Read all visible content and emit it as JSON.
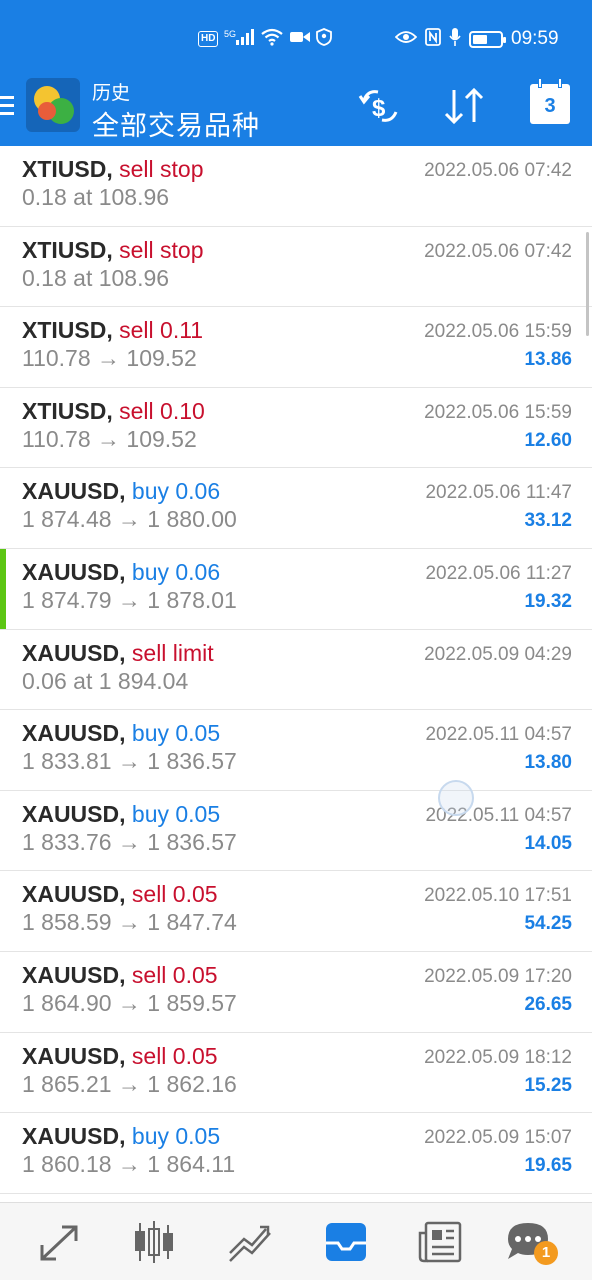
{
  "status_bar": {
    "left_icons": [
      "hd-icon",
      "5g-signal-icon",
      "wifi-icon",
      "video-camera-icon",
      "shield-icon"
    ],
    "hd_label": "HD",
    "net_label": "5G",
    "right_icons": [
      "eye-icon",
      "nfc-icon",
      "microphone-icon",
      "battery-icon"
    ],
    "time": "09:59"
  },
  "header": {
    "subtitle": "历史",
    "title": "全部交易品种",
    "calendar_day": "3",
    "actions": [
      "dollar-exchange-icon",
      "sort-icon",
      "calendar-icon"
    ]
  },
  "colors": {
    "accent": "#1a7fe4",
    "sell": "#c8102e",
    "buy": "#1a7fe4",
    "profit": "#1a7fe4",
    "selected_marker": "#5cc614"
  },
  "trades": [
    {
      "symbol": "XTIUSD,",
      "action": "sell stop",
      "side": "sell",
      "detail": "0.18 at 108.96",
      "date": "2022.05.06 07:42",
      "profit": ""
    },
    {
      "symbol": "XTIUSD,",
      "action": "sell stop",
      "side": "sell",
      "detail": "0.18 at 108.96",
      "date": "2022.05.06 07:42",
      "profit": ""
    },
    {
      "symbol": "XTIUSD,",
      "action": "sell 0.11",
      "side": "sell",
      "detail": "110.78 → 109.52",
      "date": "2022.05.06 15:59",
      "profit": "13.86"
    },
    {
      "symbol": "XTIUSD,",
      "action": "sell 0.10",
      "side": "sell",
      "detail": "110.78 → 109.52",
      "date": "2022.05.06 15:59",
      "profit": "12.60"
    },
    {
      "symbol": "XAUUSD,",
      "action": "buy 0.06",
      "side": "buy",
      "detail": "1 874.48 → 1 880.00",
      "date": "2022.05.06 11:47",
      "profit": "33.12"
    },
    {
      "symbol": "XAUUSD,",
      "action": "buy 0.06",
      "side": "buy",
      "detail": "1 874.79 → 1 878.01",
      "date": "2022.05.06 11:27",
      "profit": "19.32"
    },
    {
      "symbol": "XAUUSD,",
      "action": "sell limit",
      "side": "sell",
      "detail": "0.06 at 1 894.04",
      "date": "2022.05.09 04:29",
      "profit": ""
    },
    {
      "symbol": "XAUUSD,",
      "action": "buy 0.05",
      "side": "buy",
      "detail": "1 833.81 → 1 836.57",
      "date": "2022.05.11 04:57",
      "profit": "13.80"
    },
    {
      "symbol": "XAUUSD,",
      "action": "buy 0.05",
      "side": "buy",
      "detail": "1 833.76 → 1 836.57",
      "date": "2022.05.11 04:57",
      "profit": "14.05"
    },
    {
      "symbol": "XAUUSD,",
      "action": "sell 0.05",
      "side": "sell",
      "detail": "1 858.59 → 1 847.74",
      "date": "2022.05.10 17:51",
      "profit": "54.25"
    },
    {
      "symbol": "XAUUSD,",
      "action": "sell 0.05",
      "side": "sell",
      "detail": "1 864.90 → 1 859.57",
      "date": "2022.05.09 17:20",
      "profit": "26.65"
    },
    {
      "symbol": "XAUUSD,",
      "action": "sell 0.05",
      "side": "sell",
      "detail": "1 865.21 → 1 862.16",
      "date": "2022.05.09 18:12",
      "profit": "15.25"
    },
    {
      "symbol": "XAUUSD,",
      "action": "buy 0.05",
      "side": "buy",
      "detail": "1 860.18 → 1 864.11",
      "date": "2022.05.09 15:07",
      "profit": "19.65"
    }
  ],
  "bottom_nav": {
    "tabs": [
      "quotes-icon",
      "chart-icon",
      "trade-icon",
      "history-icon",
      "news-icon",
      "chat-icon"
    ],
    "active": "history-icon",
    "chat_badge": "1"
  }
}
